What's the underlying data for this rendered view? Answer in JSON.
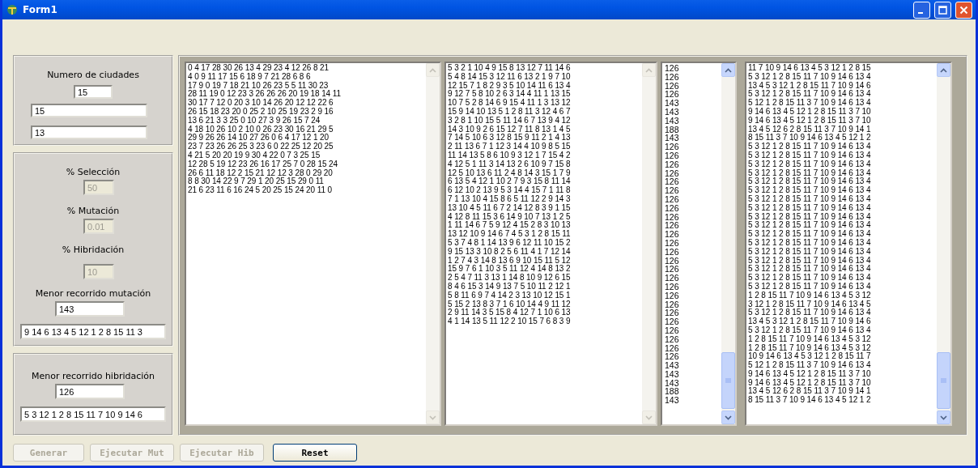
{
  "window": {
    "title": "Form1"
  },
  "cities_panel": {
    "label": "Numero de ciudades",
    "count": "15",
    "fields": [
      {
        "value": "15"
      },
      {
        "value": "13"
      }
    ]
  },
  "parameters_panel": {
    "params": [
      {
        "label": "% Selección",
        "value": "50",
        "disabled": true
      },
      {
        "label": "% Mutación",
        "value": "0.01",
        "disabled": true
      },
      {
        "label": "% Hibridación",
        "value": "10",
        "disabled": true
      }
    ],
    "best": {
      "label": "Menor recorrido mutación",
      "distance": "143",
      "route": "9 14 6 13 4 5 12 1 2 8 15 11 3"
    }
  },
  "hybrid_panel": {
    "best": {
      "label": "Menor recorrido hibridación",
      "distance": "126",
      "route": "5 3 12 1 2 8 15 11 7 10 9 14 6"
    }
  },
  "boxes": [
    {
      "kind": "memo",
      "scroll_enabled": false,
      "lines": [
        "0 4 17 28 30 26 13 4 29 23 4 12 26 8 21",
        "4 0 9 11 17 15 6 18 9 7 21 28 6 8 6",
        "17 9 0 19 7 18 21 10 26 23 5 5 11 30 23",
        "28 11 19 0 12 23 3 26 26 26 20 19 18 14 11",
        "30 17 7 12 0 20 3 10 14 26 20 12 12 22 6",
        "26 15 18 23 20 0 25 2 10 25 19 23 2 9 16",
        "13 6 21 3 3 25 0 10 27 3 9 26 15 7 24",
        "4 18 10 26 10 2 10 0 26 23 30 16 21 29 5",
        "29 9 26 26 14 10 27 26 0 6 4 17 12 1 20",
        "23 7 23 26 26 25 3 23 6 0 22 25 12 20 25",
        "4 21 5 20 20 19 9 30 4 22 0 7 3 25 15",
        "12 28 5 19 12 23 26 16 17 25 7 0 28 15 24",
        "26 6 11 18 12 2 15 21 12 12 3 28 0 29 20",
        "8 8 30 14 22 9 7 29 1 20 25 15 29 0 11",
        "21 6 23 11 6 16 24 5 20 25 15 24 20 11 0"
      ]
    },
    {
      "kind": "memo",
      "scroll_enabled": false,
      "lines": [
        "5 3 2 1 10 4 9 15 8 13 12 7 11 14 6",
        "5 4 8 14 15 3 12 11 6 13 2 1 9 7 10",
        "12 15 7 1 8 2 9 3 5 10 14 11 6 13 4",
        "9 12 7 5 8 10 2 6 3 14 4 11 1 13 15",
        "10 7 5 2 8 14 6 9 15 4 11 1 3 13 12",
        "15 9 14 10 13 5 1 2 8 11 3 12 4 6 7",
        "3 2 8 1 10 15 5 11 14 6 7 13 9 4 12",
        "14 3 10 9 2 6 15 12 7 11 8 13 1 4 5",
        "7 14 5 10 6 3 12 8 15 9 11 2 1 4 13",
        "2 11 13 6 7 1 12 3 14 4 10 9 8 5 15",
        "11 14 13 5 8 6 10 9 3 12 1 7 15 4 2",
        "4 12 5 1 11 3 14 13 2 6 10 9 7 15 8",
        "12 5 10 13 6 11 2 4 8 14 3 15 1 7 9",
        "6 13 5 4 12 1 10 2 7 9 3 15 8 11 14",
        "6 12 10 2 13 9 5 3 14 4 15 7 1 11 8",
        "7 1 13 10 4 15 8 6 5 11 12 2 9 14 3",
        "13 10 4 5 11 6 7 2 14 12 8 3 9 1 15",
        "4 12 8 11 15 3 6 14 9 10 7 13 1 2 5",
        "1 11 14 6 7 5 9 12 4 15 2 8 3 10 13",
        "13 12 10 9 14 6 7 4 5 3 1 2 8 15 11",
        "5 3 7 4 8 1 14 13 9 6 12 11 10 15 2",
        "9 15 13 3 10 8 2 5 6 11 4 1 7 12 14",
        "1 2 7 4 3 14 8 13 6 9 10 15 11 5 12",
        "15 9 7 6 1 10 3 5 11 12 4 14 8 13 2",
        "2 5 4 7 11 3 13 1 14 8 10 9 12 6 15",
        "8 4 6 15 3 14 9 13 7 5 10 11 2 12 1",
        "5 8 11 6 9 7 4 14 2 3 13 10 12 15 1",
        "5 15 2 13 8 3 7 1 6 10 14 4 9 11 12",
        "2 9 11 14 3 5 15 8 4 12 7 1 10 6 13",
        "4 1 14 13 5 11 12 2 10 15 7 6 8 3 9"
      ]
    },
    {
      "kind": "list",
      "scroll_enabled": true,
      "lines": [
        "126",
        "126",
        "126",
        "126",
        "143",
        "143",
        "143",
        "188",
        "143",
        "126",
        "126",
        "126",
        "126",
        "126",
        "126",
        "126",
        "126",
        "126",
        "126",
        "126",
        "126",
        "126",
        "126",
        "126",
        "126",
        "126",
        "126",
        "126",
        "126",
        "126",
        "126",
        "126",
        "126",
        "126",
        "143",
        "143",
        "143",
        "188",
        "143"
      ]
    },
    {
      "kind": "memo",
      "scroll_enabled": true,
      "lines": [
        "11 7 10 9 14 6 13 4 5 3 12 1 2 8 15",
        "5 3 12 1 2 8 15 11 7 10 9 14 6 13 4",
        "13 4 5 3 12 1 2 8 15 11 7 10 9 14 6",
        "5 3 12 1 2 8 15 11 7 10 9 14 6 13 4",
        "5 12 1 2 8 15 11 3 7 10 9 14 6 13 4",
        "9 14 6 13 4 5 12 1 2 8 15 11 3 7 10",
        "9 14 6 13 4 5 12 1 2 8 15 11 3 7 10",
        "13 4 5 12 6 2 8 15 11 3 7 10 9 14 1",
        "8 15 11 3 7 10 9 14 6 13 4 5 12 1 2",
        "5 3 12 1 2 8 15 11 7 10 9 14 6 13 4",
        "5 3 12 1 2 8 15 11 7 10 9 14 6 13 4",
        "5 3 12 1 2 8 15 11 7 10 9 14 6 13 4",
        "5 3 12 1 2 8 15 11 7 10 9 14 6 13 4",
        "5 3 12 1 2 8 15 11 7 10 9 14 6 13 4",
        "5 3 12 1 2 8 15 11 7 10 9 14 6 13 4",
        "5 3 12 1 2 8 15 11 7 10 9 14 6 13 4",
        "5 3 12 1 2 8 15 11 7 10 9 14 6 13 4",
        "5 3 12 1 2 8 15 11 7 10 9 14 6 13 4",
        "5 3 12 1 2 8 15 11 7 10 9 14 6 13 4",
        "5 3 12 1 2 8 15 11 7 10 9 14 6 13 4",
        "5 3 12 1 2 8 15 11 7 10 9 14 6 13 4",
        "5 3 12 1 2 8 15 11 7 10 9 14 6 13 4",
        "5 3 12 1 2 8 15 11 7 10 9 14 6 13 4",
        "5 3 12 1 2 8 15 11 7 10 9 14 6 13 4",
        "5 3 12 1 2 8 15 11 7 10 9 14 6 13 4",
        "5 3 12 1 2 8 15 11 7 10 9 14 6 13 4",
        "1 2 8 15 11 7 10 9 14 6 13 4 5 3 12",
        "3 12 1 2 8 15 11 7 10 9 14 6 13 4 5",
        "5 3 12 1 2 8 15 11 7 10 9 14 6 13 4",
        "13 4 5 3 12 1 2 8 15 11 7 10 9 14 6",
        "5 3 12 1 2 8 15 11 7 10 9 14 6 13 4",
        "1 2 8 15 11 7 10 9 14 6 13 4 5 3 12",
        "1 2 8 15 11 7 10 9 14 6 13 4 5 3 12",
        "10 9 14 6 13 4 5 3 12 1 2 8 15 11 7",
        "5 12 1 2 8 15 11 3 7 10 9 14 6 13 4",
        "9 14 6 13 4 5 12 1 2 8 15 11 3 7 10",
        "9 14 6 13 4 5 12 1 2 8 15 11 3 7 10",
        "13 4 5 12 6 2 8 15 11 3 7 10 9 14 1",
        "8 15 11 3 7 10 9 14 6 13 4 5 12 1 2"
      ]
    }
  ],
  "buttons": [
    {
      "label": "Generar",
      "disabled": true
    },
    {
      "label": "Ejecutar Mut",
      "disabled": true
    },
    {
      "label": "Ejecutar Hib",
      "disabled": true
    },
    {
      "label": "Reset",
      "disabled": false
    }
  ]
}
